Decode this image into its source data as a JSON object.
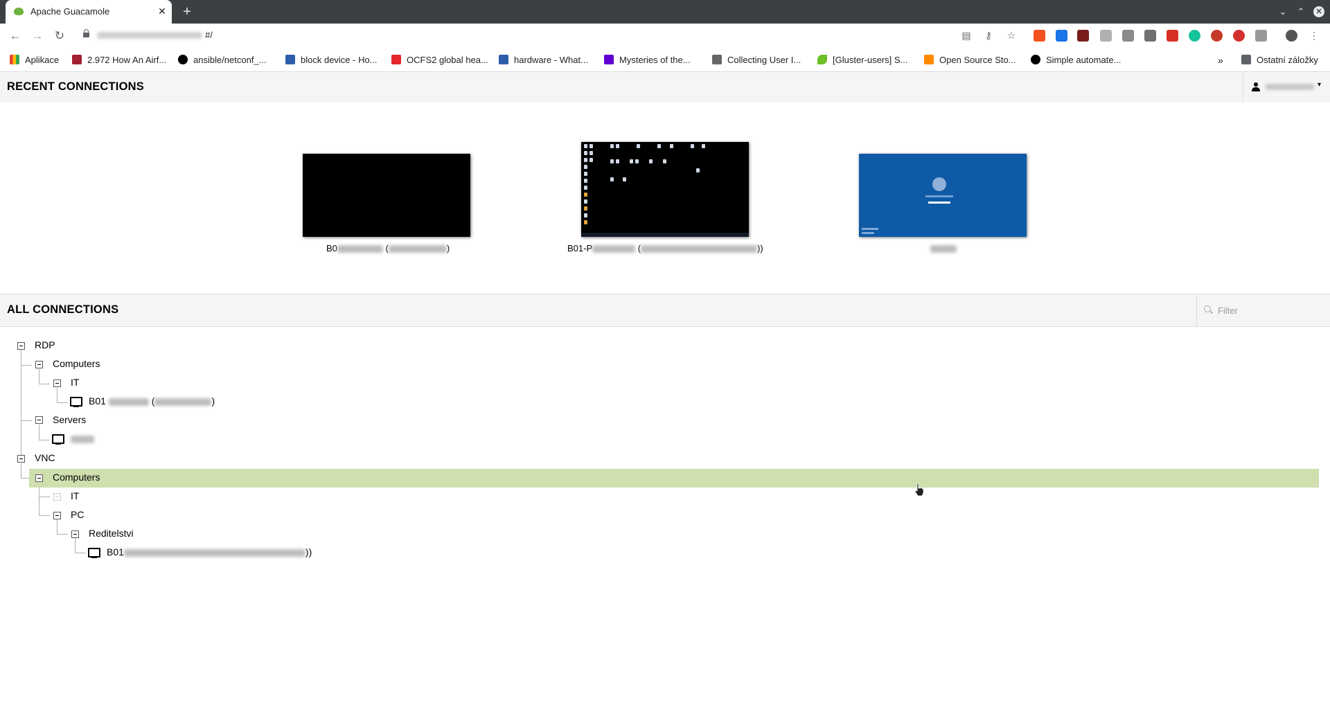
{
  "browser": {
    "tab_title": "Apache Guacamole",
    "tab_close": "✕",
    "new_tab": "+",
    "url_suffix": "#/",
    "bookmarks": [
      {
        "label": "Aplikace",
        "icon": "apps-grid-icon",
        "color": "#ea4335"
      },
      {
        "label": "2.972 How An Airf...",
        "icon": "mit-icon",
        "color": "#a31f34"
      },
      {
        "label": "ansible/netconf_...",
        "icon": "github-icon",
        "color": "#000000"
      },
      {
        "label": "block device - Ho...",
        "icon": "unix-se-icon",
        "color": "#2d5caa"
      },
      {
        "label": "OCFS2 global hea...",
        "icon": "oracle-icon",
        "color": "#e3262b"
      },
      {
        "label": "hardware - What...",
        "icon": "unix-se-icon",
        "color": "#2d5caa"
      },
      {
        "label": "Mysteries of the...",
        "icon": "yahoo-icon",
        "color": "#5f01d1"
      },
      {
        "label": "Collecting User I...",
        "icon": "page-icon",
        "color": "#666666"
      },
      {
        "label": "[Gluster-users] S...",
        "icon": "leaf-icon",
        "color": "#6fbf29"
      },
      {
        "label": "Open Source Sto...",
        "icon": "blogger-icon",
        "color": "#ff8a00"
      },
      {
        "label": "Simple automate...",
        "icon": "github-icon",
        "color": "#000000"
      }
    ],
    "more_bookmarks": "»",
    "other_bookmarks": "Ostatní záložky"
  },
  "header": {
    "title": "RECENT CONNECTIONS",
    "user_caret": "▾"
  },
  "recent": [
    {
      "label_prefix": "B0",
      "label_mid": " (",
      "label_suffix": ")",
      "preview": "black"
    },
    {
      "label_prefix": "B01-P",
      "label_mid": " (",
      "label_suffix": "))",
      "preview": "desktop"
    },
    {
      "label_prefix": "",
      "label_mid": "",
      "label_suffix": "",
      "preview": "login"
    }
  ],
  "all_connections": {
    "title": "ALL CONNECTIONS",
    "filter_placeholder": "Filter"
  },
  "tree": {
    "rdp": "RDP",
    "rdp_computers": "Computers",
    "rdp_it": "IT",
    "rdp_it_conn_prefix": "B01",
    "rdp_it_conn_mid": " (",
    "rdp_it_conn_suffix": ")",
    "rdp_servers": "Servers",
    "vnc": "VNC",
    "vnc_computers": "Computers",
    "vnc_it": "IT",
    "vnc_pc": "PC",
    "vnc_reditelstvi": "Reditelstvi",
    "vnc_conn_prefix": "B01",
    "vnc_conn_suffix": "))"
  },
  "colors": {
    "highlight_row": "#cfdfae",
    "chrome_dark": "#3c4043",
    "login_screen_blue": "#0e5aa6"
  }
}
